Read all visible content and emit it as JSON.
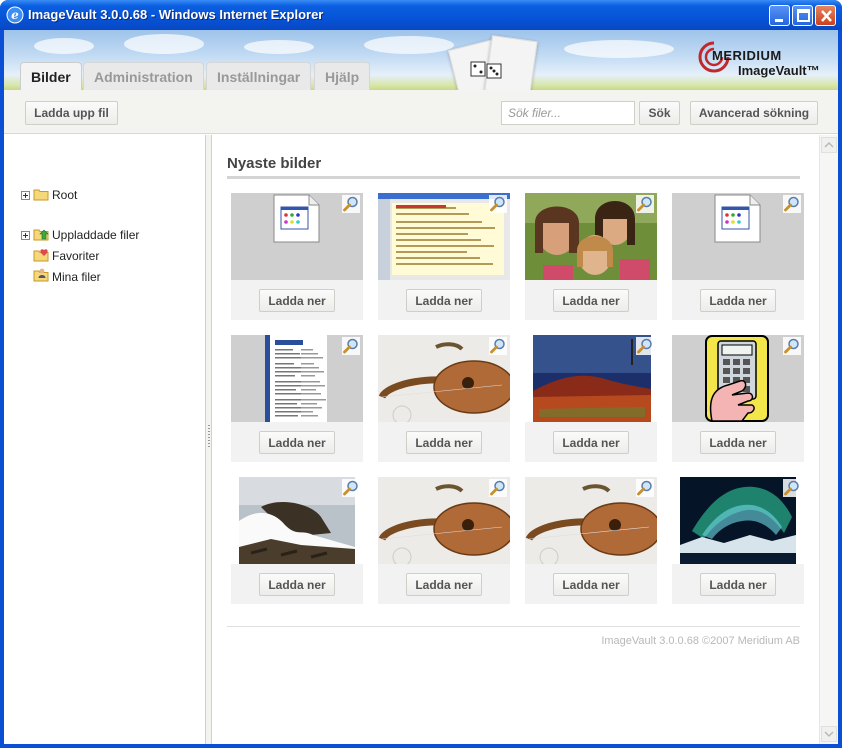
{
  "window": {
    "title": "ImageVault 3.0.0.68 - Windows Internet Explorer"
  },
  "header": {
    "logo_line1": "MERIDIUM",
    "logo_line2": "ImageVault™",
    "tabs": [
      {
        "label": "Bilder",
        "active": true
      },
      {
        "label": "Administration",
        "active": false
      },
      {
        "label": "Inställningar",
        "active": false
      },
      {
        "label": "Hjälp",
        "active": false
      }
    ]
  },
  "toolbar": {
    "upload_label": "Ladda upp fil",
    "search_placeholder": "Sök filer...",
    "search_label": "Sök",
    "advanced_search_label": "Avancerad sökning"
  },
  "tree": {
    "items": [
      {
        "label": "Root",
        "icon": "folder-icon",
        "expandable": true
      },
      {
        "label": "Uppladdade filer",
        "icon": "folder-upload-icon",
        "expandable": true
      },
      {
        "label": "Favoriter",
        "icon": "folder-favorites-icon",
        "expandable": false
      },
      {
        "label": "Mina filer",
        "icon": "folder-user-icon",
        "expandable": false
      }
    ]
  },
  "main": {
    "section_title": "Nyaste bilder",
    "download_label": "Ladda ner",
    "images": [
      {
        "kind": "file-icon"
      },
      {
        "kind": "document-screenshot"
      },
      {
        "kind": "photo-people"
      },
      {
        "kind": "file-icon"
      },
      {
        "kind": "document-page"
      },
      {
        "kind": "lute"
      },
      {
        "kind": "desert-rock"
      },
      {
        "kind": "calculator-clipart"
      },
      {
        "kind": "coast-rocks"
      },
      {
        "kind": "lute"
      },
      {
        "kind": "lute"
      },
      {
        "kind": "aurora"
      }
    ],
    "footer": "ImageVault 3.0.0.68 ©2007 Meridium AB"
  },
  "colors": {
    "title_bar": "#0654d8",
    "accent_text": "#444444",
    "thumb_bg": "#d0d0d0"
  }
}
